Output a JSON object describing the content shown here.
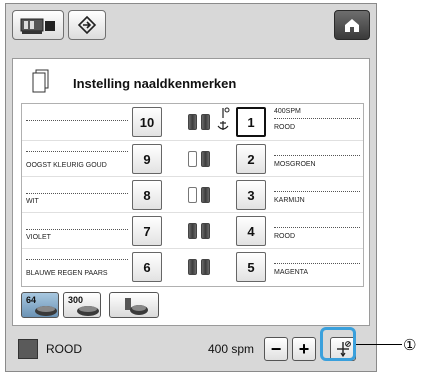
{
  "toolbar": {
    "buttons": [
      {
        "name": "machine-icon"
      },
      {
        "name": "diamond-arrow-icon"
      }
    ],
    "home_icon": "home-icon"
  },
  "panel": {
    "title": "Instelling naaldkenmerken",
    "title_icon": "document-icon"
  },
  "needles": [
    {
      "num": "10",
      "left_label": "",
      "right_num": "1",
      "right_speed": "400spm",
      "right_color": "ROOD",
      "spools": [
        "dark",
        "dark"
      ]
    },
    {
      "num": "9",
      "left_label": "OOGST KLEURIG GOUD",
      "right_num": "2",
      "right_speed": "",
      "right_color": "MOSGROEN",
      "spools": [
        "light",
        "dark"
      ]
    },
    {
      "num": "8",
      "left_label": "WIT",
      "right_num": "3",
      "right_speed": "",
      "right_color": "KARMIJN",
      "spools": [
        "light",
        "dark"
      ]
    },
    {
      "num": "7",
      "left_label": "VIOLET",
      "right_num": "4",
      "right_speed": "",
      "right_color": "ROOD",
      "spools": [
        "dark",
        "dark"
      ]
    },
    {
      "num": "6",
      "left_label": "BLAUWE REGEN PAARS",
      "right_num": "5",
      "right_speed": "",
      "right_color": "MAGENTA",
      "spools": [
        "dark",
        "dark"
      ]
    }
  ],
  "mode_buttons": [
    {
      "label": "64",
      "active": true
    },
    {
      "label": "300",
      "active": false
    },
    {
      "label": "",
      "active": false
    }
  ],
  "bottom": {
    "color_name": "ROOD",
    "speed": "400 spm",
    "minus": "−",
    "plus": "+",
    "needle_setting_icon": "needle-setting-icon"
  },
  "callout": "①",
  "colors": {
    "highlight": "#3aa0dc",
    "swatch": "#5a5a5a",
    "active_mode": "#6b93b5"
  }
}
